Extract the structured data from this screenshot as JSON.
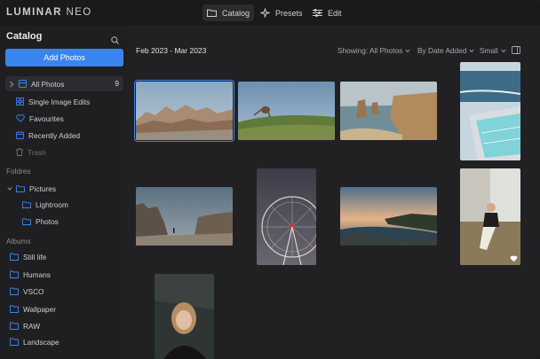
{
  "app": {
    "logo_bold": "LUMINAR",
    "logo_thin": "NEO"
  },
  "topnav": [
    {
      "label": "Catalog",
      "icon": "folder-icon",
      "active": true
    },
    {
      "label": "Presets",
      "icon": "sparkle-icon",
      "active": false
    },
    {
      "label": "Edit",
      "icon": "sliders-icon",
      "active": false
    }
  ],
  "sidebar": {
    "title": "Catalog",
    "add_button": "Add Photos",
    "all_photos": {
      "label": "All Photos",
      "count": "9"
    },
    "items": [
      {
        "label": "Single Image Edits"
      },
      {
        "label": "Favourites"
      },
      {
        "label": "Recently Added"
      },
      {
        "label": "Trash"
      }
    ],
    "folders_heading": "Foldres",
    "folders": [
      {
        "label": "Pictures"
      },
      {
        "label": "Lightroom"
      },
      {
        "label": "Photos"
      }
    ],
    "albums_heading": "Albums",
    "albums": [
      {
        "label": "Still life"
      },
      {
        "label": "Humans"
      },
      {
        "label": "VSCO"
      },
      {
        "label": "Wallpaper"
      },
      {
        "label": "RAW"
      },
      {
        "label": "Landscape"
      }
    ]
  },
  "main": {
    "date_range": "Feb 2023 - Mar 2023",
    "showing": "Showing: All Photos",
    "sort": "By Date Added",
    "size": "Small"
  },
  "colors": {
    "accent": "#3a84f0",
    "background": "#212124",
    "sidebar": "#1f1f22"
  }
}
